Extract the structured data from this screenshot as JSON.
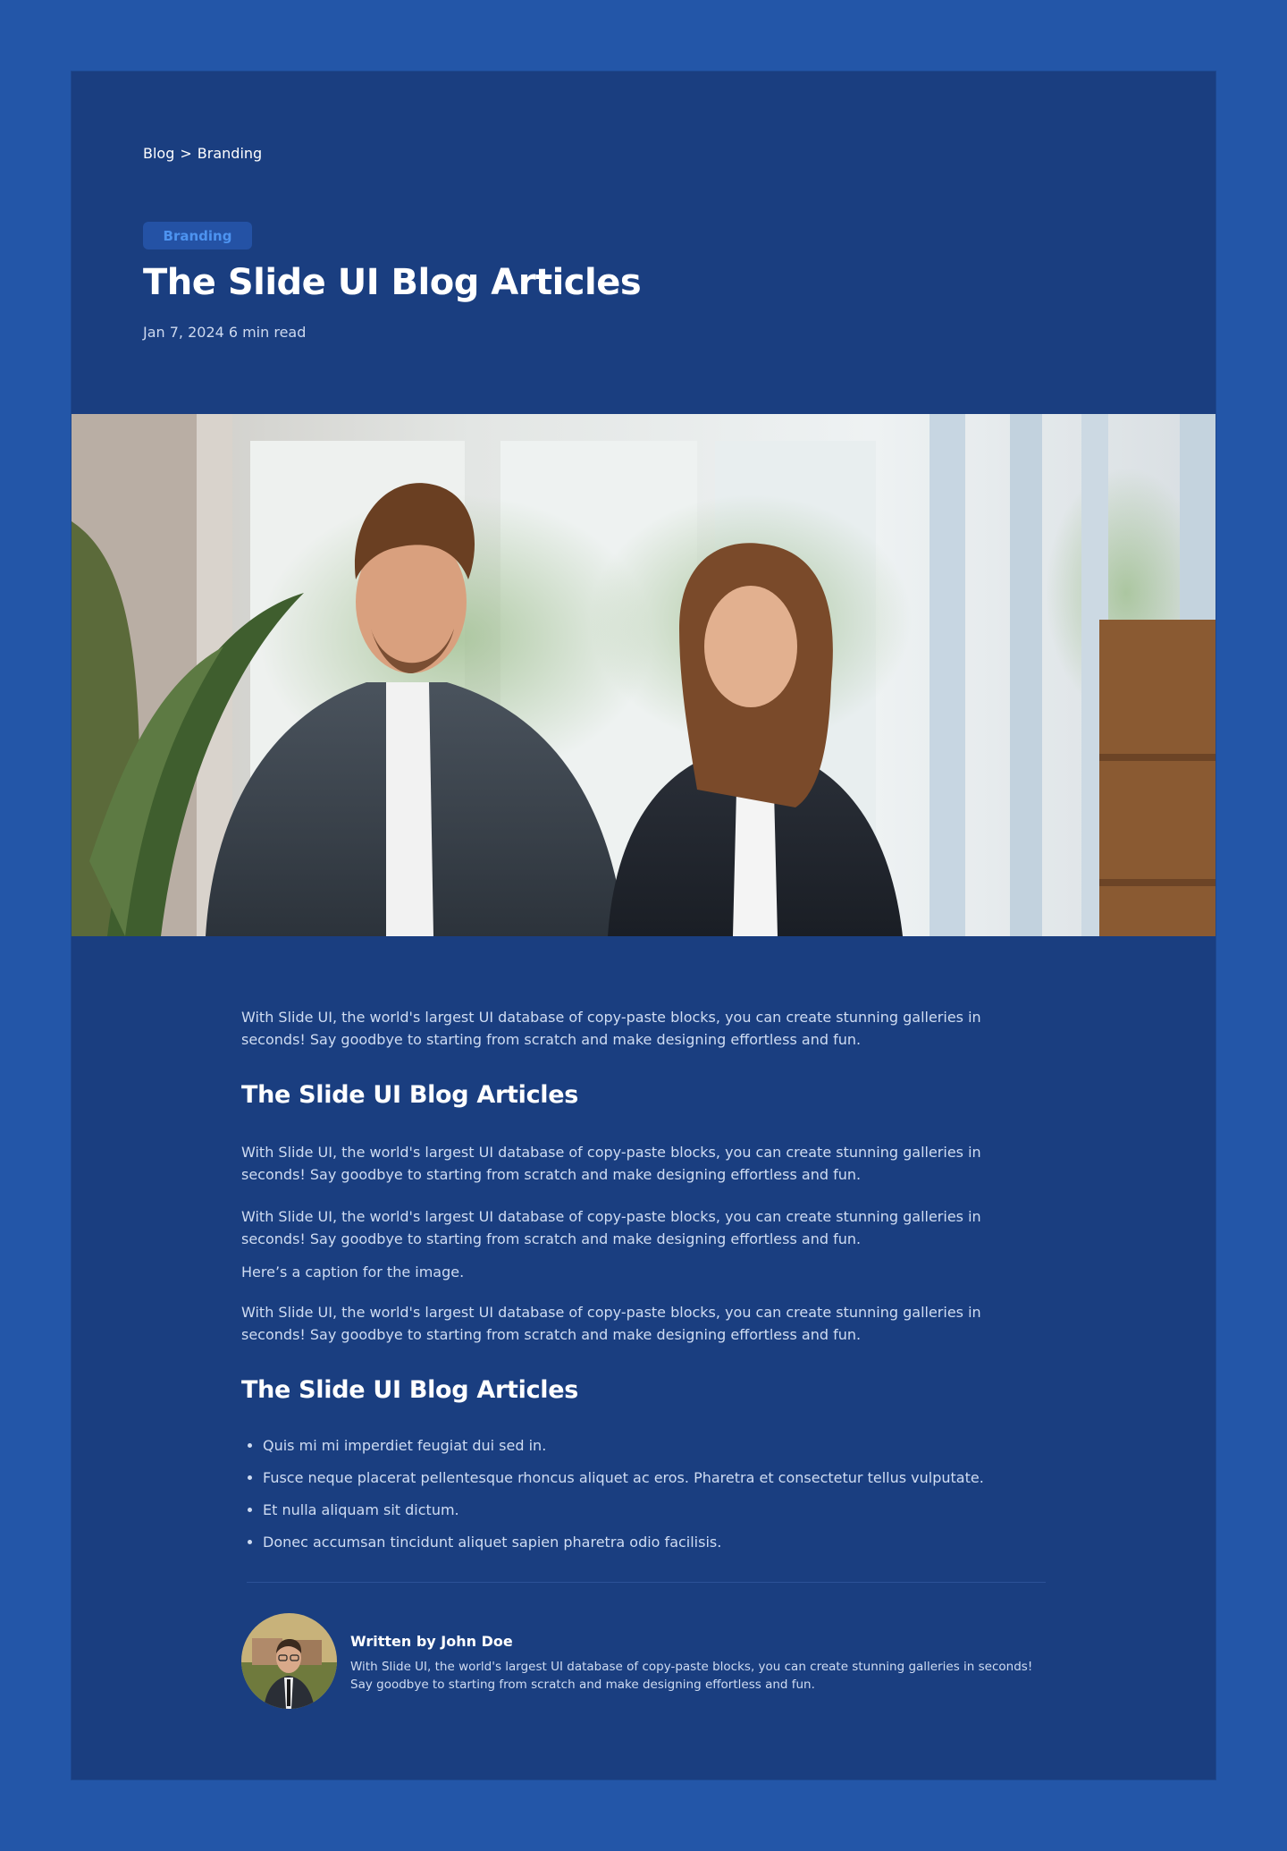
{
  "breadcrumb": {
    "root": "Blog",
    "separator": ">",
    "current": "Branding"
  },
  "hero": {
    "tag": "Branding",
    "title": "The Slide UI Blog Articles",
    "date": "Jan 7, 2024",
    "read_time": "6 min read"
  },
  "article": {
    "intro": "With Slide UI, the world's largest UI database of copy-paste blocks, you can create stunning galleries in seconds! Say goodbye to starting from scratch and make designing effortless and fun.",
    "heading_1": "The Slide UI Blog Articles",
    "para_2": "With Slide UI, the world's largest UI database of copy-paste blocks, you can create stunning galleries in seconds! Say goodbye to starting from scratch and make designing effortless and fun.",
    "para_3": "With Slide UI, the world's largest UI database of copy-paste blocks, you can create stunning galleries in seconds! Say goodbye to starting from scratch and make designing effortless and fun.",
    "caption": "Here’s a caption for the image.",
    "para_4": "With Slide UI, the world's largest UI database of copy-paste blocks, you can create stunning galleries in seconds! Say goodbye to starting from scratch and make designing effortless and fun.",
    "heading_2": "The Slide UI Blog Articles",
    "bullets": [
      "Quis mi mi imperdiet feugiat dui sed in.",
      "Fusce neque placerat pellentesque rhoncus aliquet ac eros. Pharetra et consectetur tellus vulputate.",
      "Et nulla aliquam sit dictum.",
      "Donec accumsan tincidunt aliquet sapien pharetra odio facilisis."
    ]
  },
  "author": {
    "name": "Written by John Doe",
    "bio": "With Slide UI, the world's largest UI database of copy-paste blocks, you can create stunning galleries in seconds! Say goodbye to starting from scratch and make designing effortless and fun."
  },
  "colors": {
    "page_background": "#2356a8",
    "card_background": "#1a3e80",
    "tag_background": "#2452a5",
    "tag_text": "#4d93f0",
    "heading_text": "#ffffff",
    "body_text": "#cfdcf2"
  }
}
